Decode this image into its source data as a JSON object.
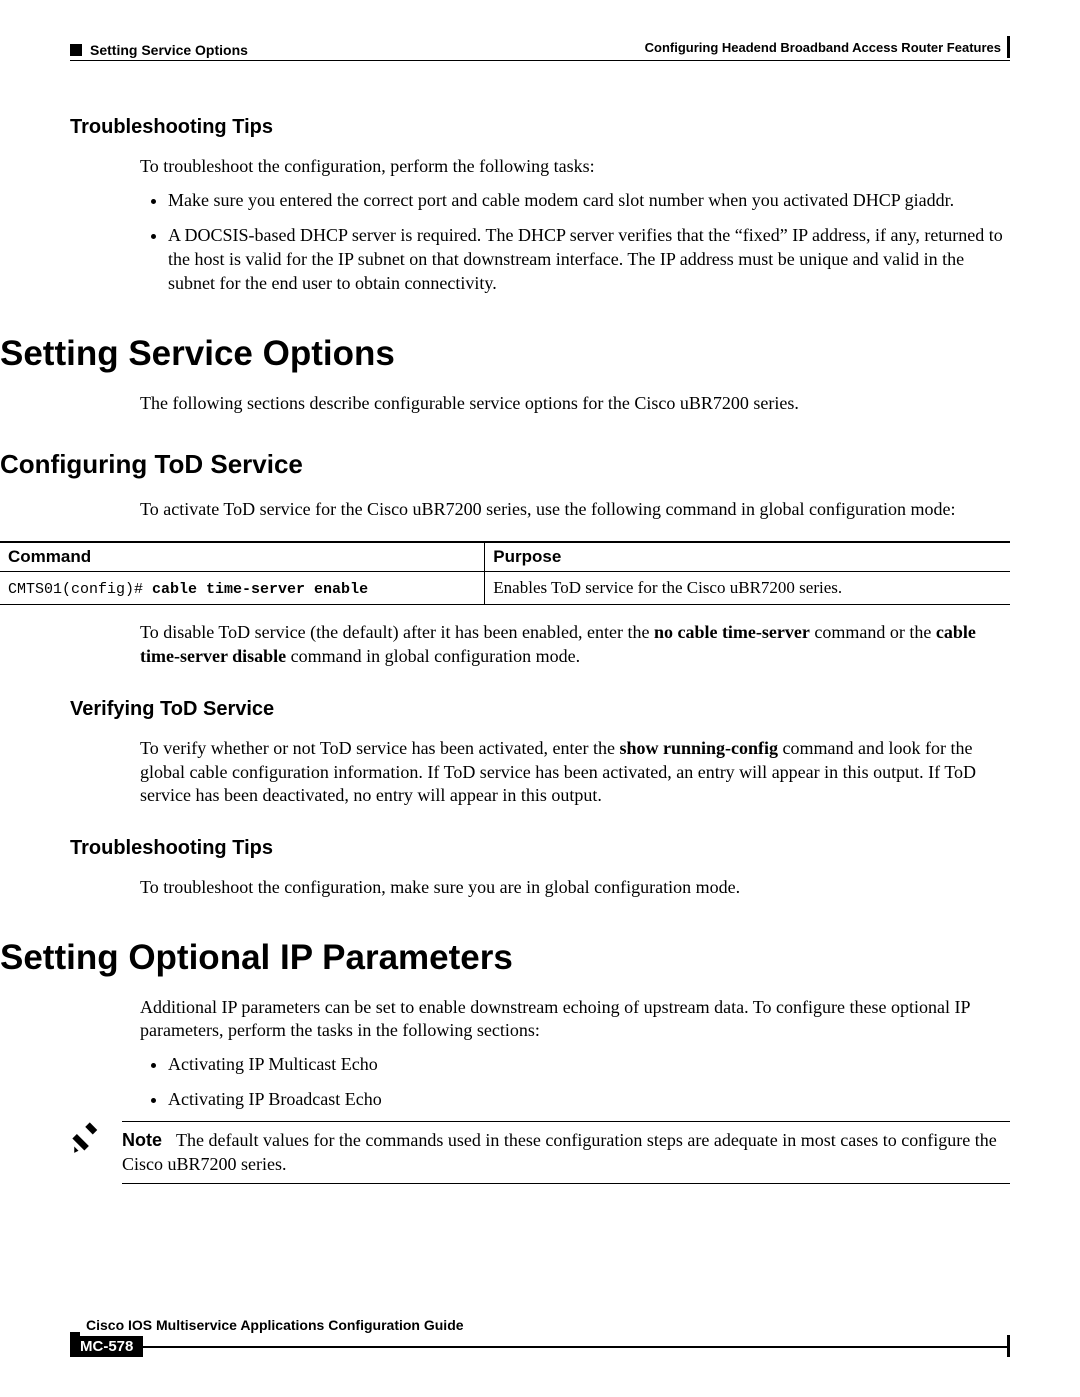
{
  "header": {
    "left": "Setting Service Options",
    "right": "Configuring Headend Broadband Access Router Features"
  },
  "sections": {
    "tips1": {
      "heading": "Troubleshooting Tips",
      "intro": "To troubleshoot the configuration, perform the following tasks:",
      "bullets": [
        "Make sure you entered the correct port and cable modem card slot number when you activated DHCP giaddr.",
        "A DOCSIS-based DHCP server is required. The DHCP server verifies that the “fixed” IP address, if any, returned to the host is valid for the IP subnet on that downstream interface. The IP address must be unique and valid in the subnet for the end user to obtain connectivity."
      ]
    },
    "setting_service": {
      "heading": "Setting Service Options",
      "intro": "The following sections describe configurable service options for the Cisco uBR7200 series."
    },
    "tod": {
      "heading": "Configuring ToD Service",
      "intro": "To activate ToD service for the Cisco uBR7200 series, use the following command in global configuration mode:",
      "table": {
        "h1": "Command",
        "h2": "Purpose",
        "cmd_prefix": "CMTS01(config)# ",
        "cmd_bold": "cable time-server enable",
        "purpose": "Enables  ToD service for the Cisco uBR7200 series."
      },
      "disable_p1": "To disable ToD service (the default) after it has been enabled, enter the ",
      "disable_b1": "no cable time-server",
      "disable_p2": " command or the ",
      "disable_b2": "cable time-server disable",
      "disable_p3": " command in global configuration mode."
    },
    "verify": {
      "heading": "Verifying ToD Service",
      "p1": "To verify whether or not ToD service has been activated, enter the ",
      "b1": "show running-config",
      "p2": " command and look for the global cable configuration information. If ToD service has been activated, an entry will appear in this output. If ToD service has been deactivated, no entry will appear in this output."
    },
    "tips2": {
      "heading": "Troubleshooting Tips",
      "intro": "To troubleshoot the configuration, make sure you are in global configuration mode."
    },
    "ip_params": {
      "heading": "Setting Optional IP Parameters",
      "intro": "Additional IP parameters can be set to enable downstream echoing of upstream data.  To configure these optional IP parameters, perform the tasks in the following sections:",
      "bullets": [
        "Activating IP Multicast Echo",
        "Activating IP Broadcast Echo"
      ],
      "note_label": "Note",
      "note_text": "The default values for the commands used in these configuration steps are adequate in most cases to configure the Cisco uBR7200 series."
    }
  },
  "footer": {
    "guide": "Cisco IOS Multiservice Applications Configuration Guide",
    "page": "MC-578"
  }
}
